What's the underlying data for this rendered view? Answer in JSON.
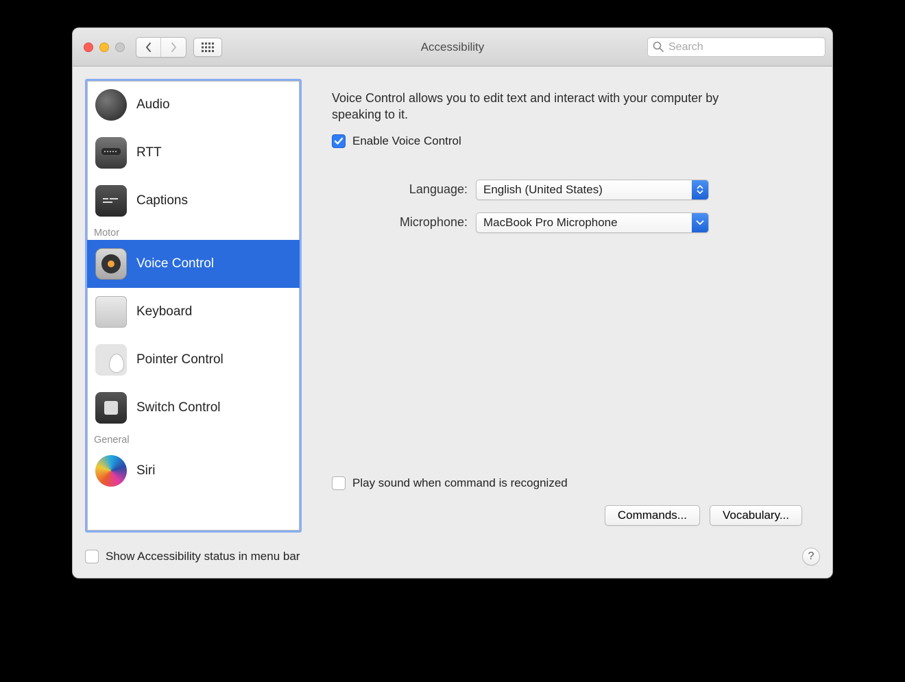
{
  "window": {
    "title": "Accessibility"
  },
  "search": {
    "placeholder": "Search"
  },
  "sidebar": {
    "groups": {
      "motor": "Motor",
      "general": "General"
    },
    "items": [
      {
        "label": "Audio"
      },
      {
        "label": "RTT"
      },
      {
        "label": "Captions"
      },
      {
        "label": "Voice Control"
      },
      {
        "label": "Keyboard"
      },
      {
        "label": "Pointer Control"
      },
      {
        "label": "Switch Control"
      },
      {
        "label": "Siri"
      }
    ]
  },
  "main": {
    "description": "Voice Control allows you to edit text and interact with your computer by speaking to it.",
    "enable_label": "Enable Voice Control",
    "enable_checked": true,
    "language_label": "Language:",
    "language_value": "English (United States)",
    "microphone_label": "Microphone:",
    "microphone_value": "MacBook Pro Microphone",
    "play_sound_label": "Play sound when command is recognized",
    "play_sound_checked": false,
    "commands_button": "Commands...",
    "vocabulary_button": "Vocabulary..."
  },
  "footer": {
    "menubar_label": "Show Accessibility status in menu bar",
    "menubar_checked": false,
    "help_label": "?"
  }
}
